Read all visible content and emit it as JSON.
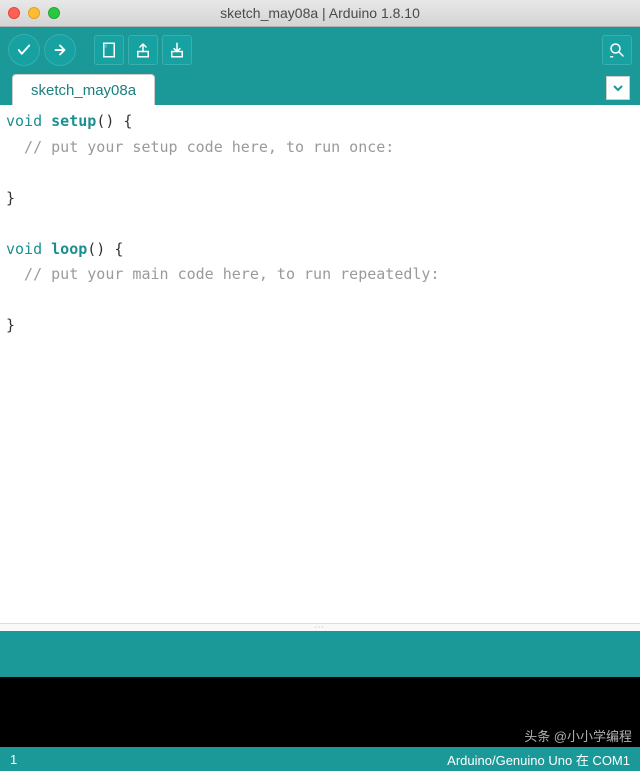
{
  "window": {
    "title": "sketch_may08a | Arduino 1.8.10"
  },
  "tabs": {
    "active": "sketch_may08a"
  },
  "code": {
    "kw1": "void",
    "fn1": "setup",
    "sig1": "() {",
    "cm1": "  // put your setup code here, to run once:",
    "blank1": "",
    "close1": "}",
    "blank2": "",
    "kw2": "void",
    "fn2": "loop",
    "sig2": "() {",
    "cm2": "  // put your main code here, to run repeatedly:",
    "blank3": "",
    "close2": "}"
  },
  "status": {
    "line": "1",
    "board": "Arduino/Genuino Uno 在 COM1"
  },
  "watermark": "头条 @小小学编程"
}
